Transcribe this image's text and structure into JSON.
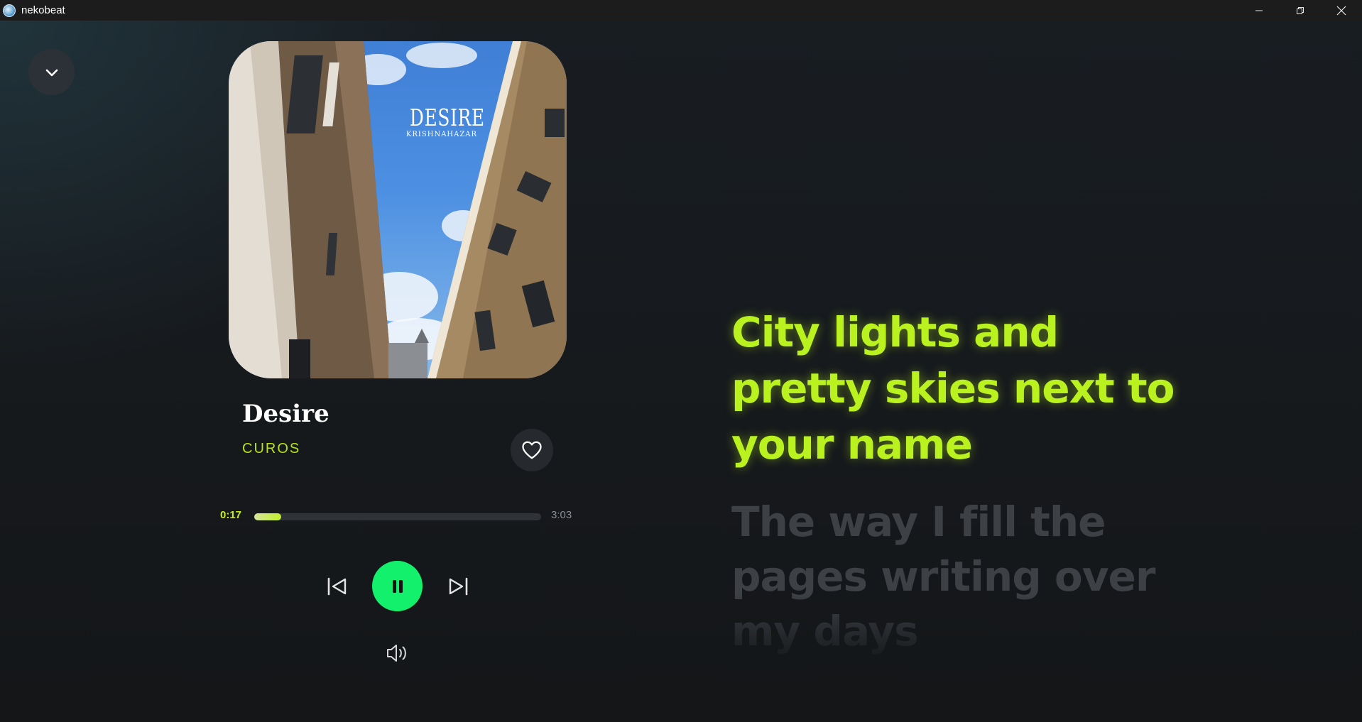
{
  "window": {
    "title": "nekobeat",
    "icons": [
      "app-icon",
      "minimize-icon",
      "restore-icon",
      "close-icon"
    ]
  },
  "player": {
    "collapse_icon": "chevron-down-icon",
    "album_art": {
      "title": "DESIRE",
      "subtitle": "KRISHNAHAZAR"
    },
    "track": {
      "title": "Desire",
      "artist": "CUROS"
    },
    "like_icon": "heart-icon",
    "progress": {
      "current": "0:17",
      "total": "3:03",
      "fraction": 0.093
    },
    "controls": {
      "previous_icon": "skip-previous-icon",
      "play_pause_icon": "pause-icon",
      "next_icon": "skip-next-icon",
      "volume_icon": "volume-icon"
    },
    "colors": {
      "accent": "#c7ef1f",
      "play_button": "#13f06c",
      "lyric_active": "#b9f21e",
      "lyric_inactive": "#3d4146"
    }
  },
  "lyrics": {
    "active": "City lights and pretty skies next to your name",
    "next": "The way I fill the pages writing over my days"
  }
}
